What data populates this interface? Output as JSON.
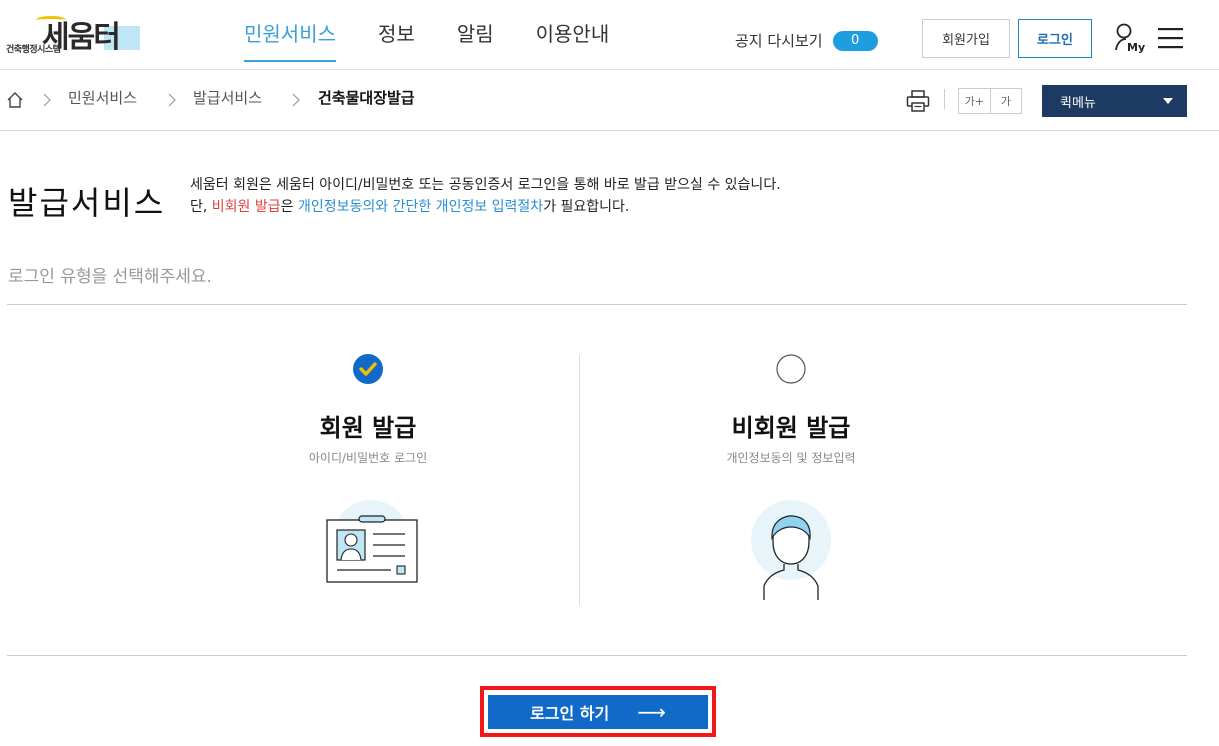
{
  "header": {
    "logo_main": "세움터",
    "logo_sub": "건축행정시스템",
    "nav": [
      "민원서비스",
      "정보",
      "알림",
      "이용안내"
    ],
    "notice_label": "공지 다시보기",
    "notice_count": "0",
    "join_label": "회원가입",
    "login_label": "로그인",
    "my_label": "My"
  },
  "breadcrumb": {
    "items": [
      "민원서비스",
      "발급서비스",
      "건축물대장발급"
    ]
  },
  "tools": {
    "font_increase": "가+",
    "font_default": "가",
    "quickmenu_label": "퀵메뉴"
  },
  "page": {
    "title": "발급서비스",
    "desc_line1": "세움터 회원은 세움터 아이디/비밀번호 또는 공동인증서 로그인을 통해 바로 발급 받으실 수 있습니다.",
    "desc_line2_prefix": "단, ",
    "desc_line2_red": "비회원 발급",
    "desc_line2_mid": "은 ",
    "desc_line2_blue": "개인정보동의와 간단한 개인정보 입력절차",
    "desc_line2_suffix": "가 필요합니다.",
    "instruction": "로그인 유형을 선택해주세요."
  },
  "options": [
    {
      "title": "회원 발급",
      "subtitle": "아이디/비밀번호 로그인",
      "selected": true
    },
    {
      "title": "비회원 발급",
      "subtitle": "개인정보동의 및 정보입력",
      "selected": false
    }
  ],
  "action": {
    "login_button": "로그인 하기",
    "arrow": "⟶"
  },
  "colors": {
    "accent": "#3aa0d8",
    "primary_button": "#1169c8",
    "quickmenu": "#1d3a63",
    "highlight_outline": "#f01818",
    "check": "#f2c200"
  }
}
